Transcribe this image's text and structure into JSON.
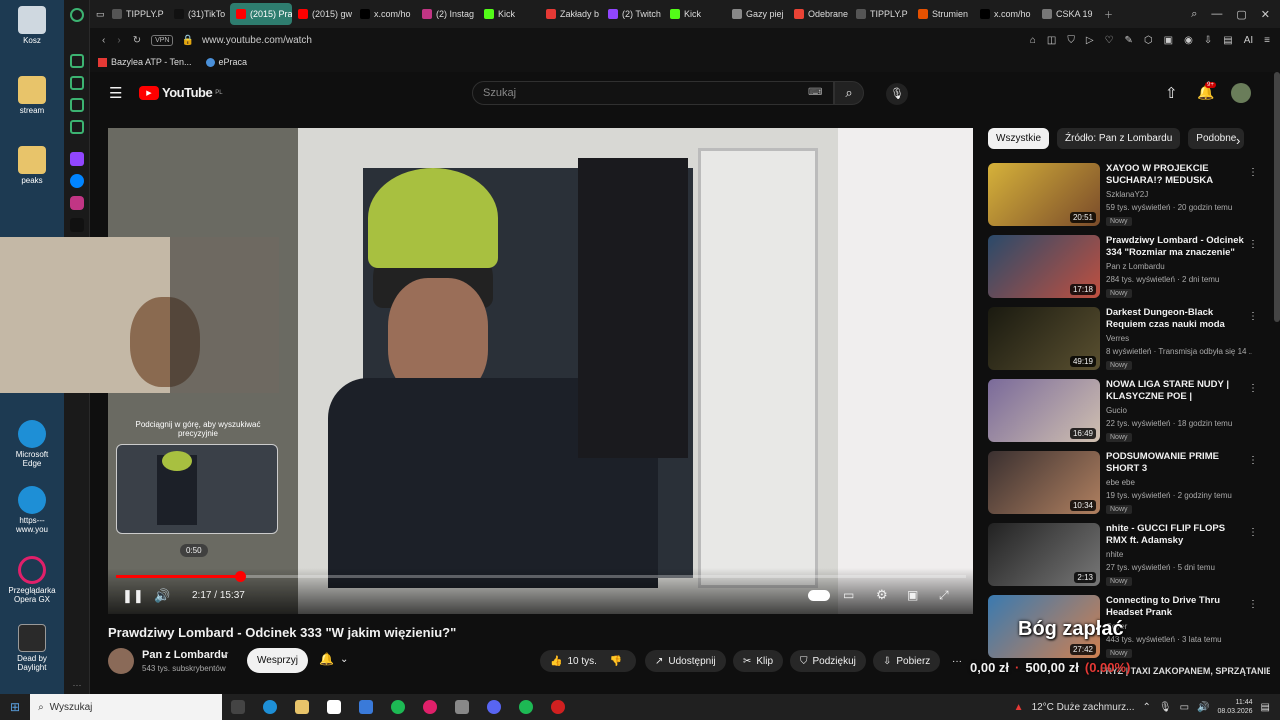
{
  "desktop": {
    "icons": [
      {
        "label": "Kosz",
        "icon": "recycle-bin-icon"
      },
      {
        "label": "stream",
        "icon": "folder-icon"
      },
      {
        "label": "peaks",
        "icon": "folder-icon"
      },
      {
        "label": "Microsoft Edge",
        "icon": "edge-icon"
      },
      {
        "label": "https---www.you",
        "icon": "edge-icon"
      },
      {
        "label": "Przeglądarka Opera GX",
        "icon": "opera-gx-icon"
      },
      {
        "label": "Dead by Daylight",
        "icon": "game-icon"
      }
    ]
  },
  "tabs": [
    {
      "label": "TIPPLY.P",
      "color": "#555555"
    },
    {
      "label": "(31)TikTo",
      "color": "#111111"
    },
    {
      "label": "(2015) Prawd",
      "color": "#ff0000",
      "active": true
    },
    {
      "label": "(2015) gw",
      "color": "#ff0000"
    },
    {
      "label": "x.com/ho",
      "color": "#000000"
    },
    {
      "label": "(2) Instag",
      "color": "#c13584"
    },
    {
      "label": "Kick",
      "color": "#53fc18"
    },
    {
      "label": "Zakłady b",
      "color": "#e53935"
    },
    {
      "label": "(2) Twitch",
      "color": "#9146ff"
    },
    {
      "label": "Kick",
      "color": "#53fc18"
    },
    {
      "label": "Gazy piej",
      "color": "#888888"
    },
    {
      "label": "Odebrane",
      "color": "#ea4335"
    },
    {
      "label": "TIPPLY.P",
      "color": "#555555"
    },
    {
      "label": "Strumien",
      "color": "#e65100"
    },
    {
      "label": "x.com/ho",
      "color": "#000000"
    },
    {
      "label": "CSKA 19",
      "color": "#777777"
    }
  ],
  "address": {
    "url": "www.youtube.com/watch",
    "vpn": "VPN",
    "ai": "AI"
  },
  "bookmarks": [
    "Bazylea ATP - Ten...",
    "ePraca"
  ],
  "youtube": {
    "logo": "YouTube",
    "logo_sup": "PL",
    "search_placeholder": "Szukaj",
    "notif_count": "9+"
  },
  "player": {
    "time_current": "2:17",
    "time_sep": " / ",
    "time_total": "15:37",
    "hover_time": "0:50",
    "seek_hint": "Podciągnij w górę, aby wyszukiwać precyzyjnie",
    "progress_fraction": 0.146
  },
  "overlay": {
    "text_big": "Bóg zapłać",
    "donation_amount": "0,00 zł",
    "donation_goal": "500,00 zł",
    "donation_pct": "(0.00%)"
  },
  "video": {
    "title": "Prawdziwy Lombard - Odcinek 333 \"W jakim więzieniu?\"",
    "channel": "Pan z Lombardu",
    "subs": "543 tys. subskrybentów",
    "subscribe": "Wesprzyj",
    "likes": "10 tys.",
    "share": "Udostępnij",
    "clip": "Klip",
    "thanks": "Podziękuj",
    "download": "Pobierz",
    "more": "···"
  },
  "chips": [
    "Wszystkie",
    "Źródło: Pan z Lombardu",
    "Podobne"
  ],
  "recs": [
    {
      "title": "XAYOO W PROJEKCIE SUCHARA!? MEDUSKA STREA...",
      "channel": "SzklanaY2J",
      "meta": "59 tys. wyświetleń · 20 godzin temu",
      "badge": "Nowy",
      "dur": "20:51",
      "c1": "#d6b23a",
      "c2": "#7a4b2a"
    },
    {
      "title": "Prawdziwy Lombard - Odcinek 334 \"Rozmiar ma znaczenie\"",
      "channel": "Pan z Lombardu",
      "meta": "284 tys. wyświetleń · 2 dni temu",
      "badge": "Nowy",
      "dur": "17:18",
      "c1": "#2a4a6a",
      "c2": "#c05040"
    },
    {
      "title": "Darkest Dungeon-Black Requiem czas nauki moda",
      "channel": "Verres",
      "meta": "8 wyświetleń · Transmisja odbyła się 14 ...",
      "badge": "Nowy",
      "dur": "49:19",
      "c1": "#1a1a10",
      "c2": "#5a5030"
    },
    {
      "title": "NOWA LIGA STARE NUDY | KLASYCZNE POE |",
      "channel": "Gucio",
      "meta": "22 tys. wyświetleń · 18 godzin temu",
      "badge": "Nowy",
      "dur": "16:49",
      "c1": "#7a6a9a",
      "c2": "#d0c0b0"
    },
    {
      "title": "PODSUMOWANIE PRIME SHORT 3",
      "channel": "ebe ebe",
      "meta": "19 tys. wyświetleń · 2 godziny temu",
      "badge": "Nowy",
      "dur": "10:34",
      "c1": "#3a3030",
      "c2": "#b08060"
    },
    {
      "title": "nhite - GUCCI FLIP FLOPS RMX ft. Adamsky",
      "channel": "nhite",
      "meta": "27 tys. wyświetleń · 5 dni temu",
      "badge": "Nowy",
      "dur": "2:13",
      "c1": "#222222",
      "c2": "#777777"
    },
    {
      "title": "Connecting to Drive Thru Headset Prank",
      "channel": "Ceyer",
      "meta": "443 tys. wyświetleń · 3 lata temu",
      "badge": "Nowy",
      "dur": "27:42",
      "c1": "#3a7ab0",
      "c2": "#d08050"
    }
  ],
  "extra_rec_title": "FRYZ | TAXI ZAKOPANEM, SPRZĄTANIE KEMPINGU",
  "taskbar": {
    "search": "Wyszukaj",
    "weather": "12°C  Duże zachmurz...",
    "time": "11:44",
    "date": "08.03.2026"
  }
}
